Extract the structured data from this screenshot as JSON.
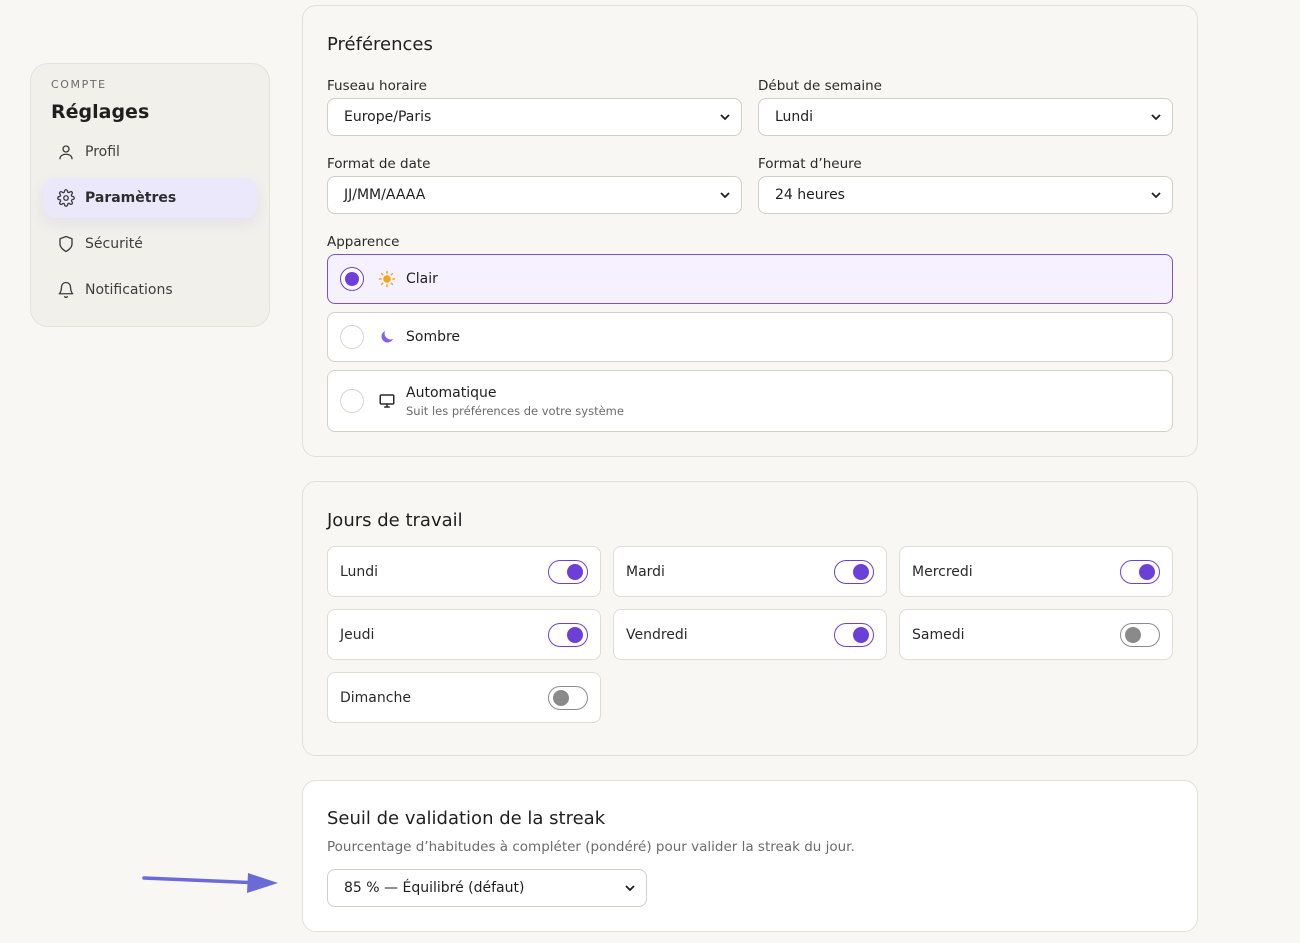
{
  "sidebar": {
    "overline": "COMPTE",
    "title": "Réglages",
    "items": [
      {
        "label": "Profil",
        "icon": "user-icon"
      },
      {
        "label": "Paramètres",
        "icon": "gear-icon",
        "active": true
      },
      {
        "label": "Sécurité",
        "icon": "shield-icon"
      },
      {
        "label": "Notifications",
        "icon": "bell-icon"
      }
    ]
  },
  "preferences": {
    "title": "Préférences",
    "timezone": {
      "label": "Fuseau horaire",
      "value": "Europe/Paris"
    },
    "week_start": {
      "label": "Début de semaine",
      "value": "Lundi"
    },
    "date_format": {
      "label": "Format de date",
      "value": "JJ/MM/AAAA"
    },
    "time_format": {
      "label": "Format d’heure",
      "value": "24 heures"
    },
    "appearance": {
      "label": "Apparence",
      "options": [
        {
          "label": "Clair",
          "icon": "sun-icon",
          "selected": true
        },
        {
          "label": "Sombre",
          "icon": "moon-icon",
          "selected": false
        },
        {
          "label": "Automatique",
          "sub": "Suit les préférences de votre système",
          "icon": "monitor-icon",
          "selected": false
        }
      ]
    }
  },
  "workdays": {
    "title": "Jours de travail",
    "days": [
      {
        "label": "Lundi",
        "on": true
      },
      {
        "label": "Mardi",
        "on": true
      },
      {
        "label": "Mercredi",
        "on": true
      },
      {
        "label": "Jeudi",
        "on": true
      },
      {
        "label": "Vendredi",
        "on": true
      },
      {
        "label": "Samedi",
        "on": false
      },
      {
        "label": "Dimanche",
        "on": false
      }
    ]
  },
  "streak": {
    "title": "Seuil de validation de la streak",
    "description": "Pourcentage d’habitudes à compléter (pondéré) pour valider la streak du jour.",
    "threshold": {
      "value": "85 % — Équilibré (défaut)"
    }
  },
  "colors": {
    "accent": "#6d3fd9",
    "active_nav_bg": "#ece8fb",
    "sun": "#f2a516",
    "moon": "#8b5cf6",
    "arrow": "#6a6ad8"
  }
}
